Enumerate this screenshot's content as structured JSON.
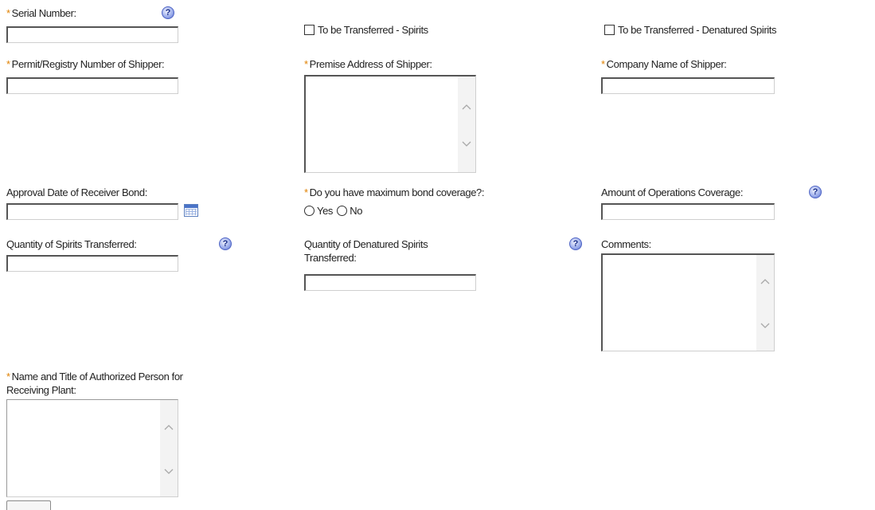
{
  "form": {
    "required_marker": "*",
    "help_glyph": "?",
    "serial_number": {
      "label": "Serial Number:",
      "value": ""
    },
    "to_be_transferred_spirits": {
      "label": "To be Transferred - Spirits",
      "checked": false
    },
    "to_be_transferred_denatured": {
      "label": "To be Transferred - Denatured Spirits",
      "checked": false
    },
    "permit_registry_number": {
      "label": "Permit/Registry Number of Shipper:",
      "value": ""
    },
    "premise_address": {
      "label": "Premise Address of Shipper:",
      "value": ""
    },
    "company_name": {
      "label": "Company Name of Shipper:",
      "value": ""
    },
    "approval_date": {
      "label": "Approval Date of Receiver Bond:",
      "value": ""
    },
    "max_bond_coverage": {
      "label": "Do you have maximum bond coverage?:",
      "options": [
        "Yes",
        "No"
      ],
      "selected": ""
    },
    "operations_coverage": {
      "label": "Amount of Operations Coverage:",
      "value": ""
    },
    "spirits_quantity": {
      "label": "Quantity of Spirits Transferred:",
      "value": ""
    },
    "denatured_quantity": {
      "label_line1": "Quantity of Denatured Spirits",
      "label_line2": "Transferred:",
      "value": ""
    },
    "comments": {
      "label": "Comments:",
      "value": ""
    },
    "authorized_person": {
      "label_line1": "Name and Title of Authorized Person for",
      "label_line2": "Receiving Plant:",
      "value": ""
    }
  },
  "icons": {
    "help": "help-icon",
    "calendar": "calendar-icon",
    "scroll_up": "chevron-up-icon",
    "scroll_down": "chevron-down-icon"
  },
  "colors": {
    "required": "#e08000",
    "help_icon": "#5a6fcf",
    "input_border_dark": "#555555"
  }
}
